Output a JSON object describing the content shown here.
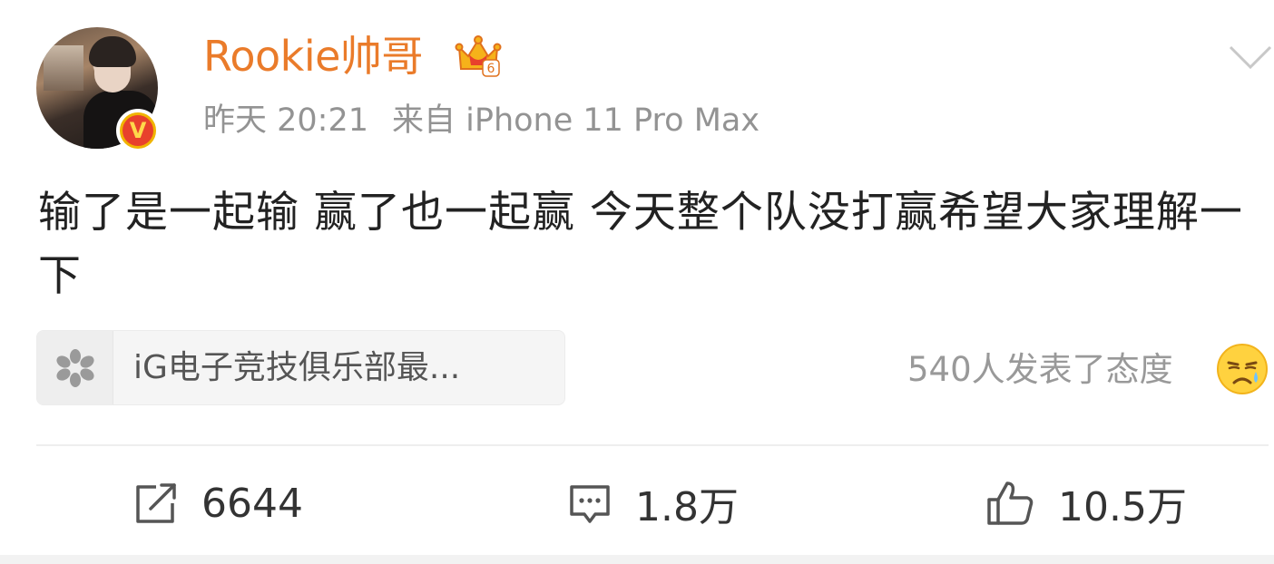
{
  "author": {
    "name": "Rookie帅哥",
    "badge_level": "6",
    "verified_mark": "V"
  },
  "meta": {
    "time": "昨天 20:21",
    "source": "来自 iPhone 11 Pro Max"
  },
  "post": {
    "text": "输了是一起输 赢了也一起赢 今天整个队没打赢希望大家理解一下"
  },
  "topic": {
    "label": "iG电子竞技俱乐部最..."
  },
  "reactions": {
    "summary": "540人发表了态度",
    "emoji": "sad-face-icon"
  },
  "actions": {
    "repost_count": "6644",
    "comment_count": "1.8万",
    "like_count": "10.5万"
  },
  "colors": {
    "username": "#ea7b2a",
    "meta": "#939393",
    "text": "#222222",
    "badge_gold": "#f0b400",
    "badge_red": "#e8412c"
  }
}
